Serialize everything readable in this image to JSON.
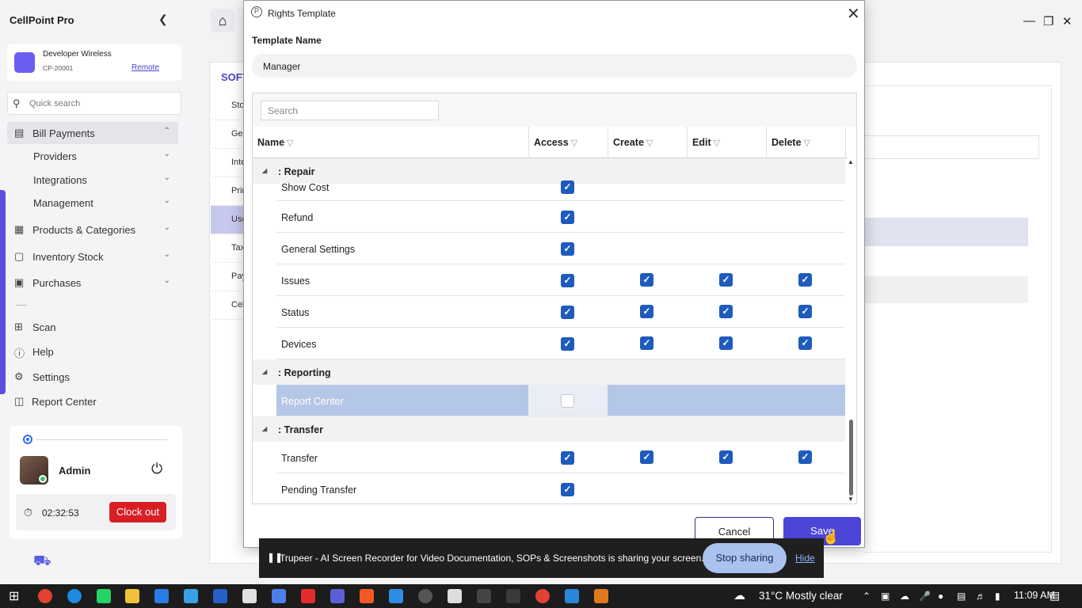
{
  "app": {
    "title": "CellPoint Pro",
    "collapse_icon": "chevron-left-icon"
  },
  "device": {
    "name": "Developer Wireless",
    "id": "CP-20001",
    "link": "Remote"
  },
  "quick_search": {
    "placeholder": "Quick search"
  },
  "nav": [
    {
      "label": "Bill Payments",
      "icon": "receipt-icon",
      "chevron": "up"
    },
    {
      "label": "Providers",
      "chevron": "down"
    },
    {
      "label": "Integrations",
      "chevron": "down"
    },
    {
      "label": "Management",
      "chevron": "down"
    },
    {
      "label": "Products & Categories",
      "icon": "grid-icon",
      "chevron": "down"
    },
    {
      "label": "Inventory Stock",
      "icon": "box-icon",
      "chevron": "down"
    },
    {
      "label": "Purchases",
      "icon": "cart-icon",
      "chevron": "down"
    },
    {
      "label": "Scan",
      "icon": "scan-icon"
    },
    {
      "label": "Help",
      "icon": "help-icon"
    },
    {
      "label": "Settings",
      "icon": "gear-icon"
    },
    {
      "label": "Report Center",
      "icon": "report-icon"
    }
  ],
  "user": {
    "name": "Admin",
    "timer": "02:32:53",
    "clock_out": "Clock out"
  },
  "background": {
    "section_title": "SOFT",
    "side_tabs": [
      "Sto",
      "Ger",
      "Inte",
      "Prin",
      "Use",
      "Tax",
      "Pay",
      "Cell"
    ]
  },
  "modal": {
    "title": "Rights Template",
    "template_name_label": "Template Name",
    "template_name_value": "Manager",
    "search_placeholder": "Search",
    "columns": [
      "Name",
      "Access",
      "Create",
      "Edit",
      "Delete"
    ],
    "groups": [
      {
        "title": ": Repair",
        "rows": [
          {
            "name": "Show Cost",
            "access": true,
            "create": null,
            "edit": null,
            "delete": null
          },
          {
            "name": "Refund",
            "access": true,
            "create": null,
            "edit": null,
            "delete": null
          },
          {
            "name": "General Settings",
            "access": true,
            "create": null,
            "edit": null,
            "delete": null
          },
          {
            "name": "Issues",
            "access": true,
            "create": true,
            "edit": true,
            "delete": true
          },
          {
            "name": "Status",
            "access": true,
            "create": true,
            "edit": true,
            "delete": true
          },
          {
            "name": "Devices",
            "access": true,
            "create": true,
            "edit": true,
            "delete": true
          }
        ]
      },
      {
        "title": ": Reporting",
        "rows": [
          {
            "name": "Report Center",
            "access": false,
            "create": null,
            "edit": null,
            "delete": null,
            "selected": true
          }
        ]
      },
      {
        "title": ": Transfer",
        "rows": [
          {
            "name": "Transfer",
            "access": true,
            "create": true,
            "edit": true,
            "delete": true
          },
          {
            "name": "Pending Transfer",
            "access": true,
            "create": null,
            "edit": null,
            "delete": null
          }
        ]
      }
    ],
    "cancel": "Cancel",
    "save": "Save"
  },
  "share_bar": {
    "text": "Trupeer - AI Screen Recorder for Video Documentation, SOPs & Screenshots is sharing your screen.",
    "stop": "Stop sharing",
    "hide": "Hide"
  },
  "taskbar": {
    "weather": "31°C  Mostly clear",
    "time": "11:09 AM"
  },
  "colors": {
    "accent": "#4b45d8",
    "checkbox": "#1e5bbd",
    "clock_out": "#d81f26"
  }
}
